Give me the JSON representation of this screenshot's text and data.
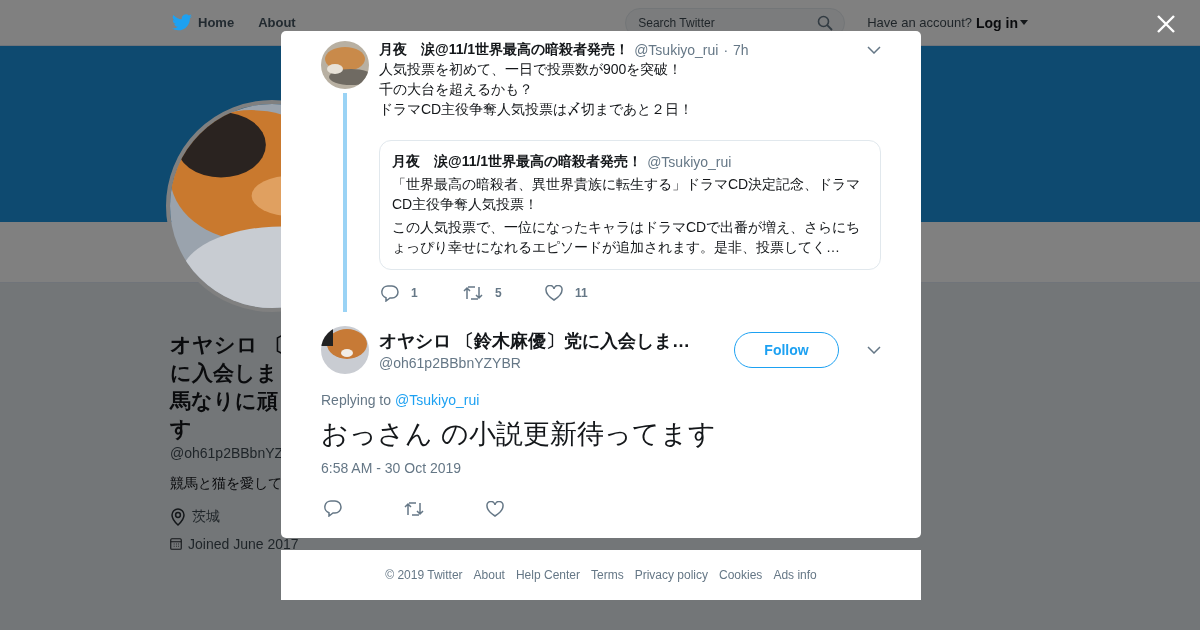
{
  "nav": {
    "links": [
      {
        "label": "Home",
        "kind": "home"
      },
      {
        "label": "About",
        "kind": "plain"
      }
    ],
    "search": {
      "placeholder": "Search Twitter"
    },
    "account_prompt": "Have an account?",
    "login": "Log in"
  },
  "profile": {
    "name_lines": [
      "オヤシロ 〔",
      "に入会しま",
      "馬なりに頑",
      "す"
    ],
    "handle": "@oh61p2BBbnYZ",
    "bio": "競馬と猫を愛して",
    "location": "茨城",
    "joined": "Joined June 2017"
  },
  "dialog": {
    "parent": {
      "name": "月夜　涙@11/1世界最高の暗殺者発売！",
      "handle": "@Tsukiyo_rui",
      "separator": "·",
      "time": "7h",
      "lines": [
        "人気投票を初めて、一日で投票数が900を突破！",
        "千の大台を超えるかも？",
        "ドラマCD主役争奪人気投票は〆切まであと２日！"
      ],
      "quote": {
        "name": "月夜　涙@11/1世界最高の暗殺者発売！",
        "handle": "@Tsukiyo_rui",
        "lines": [
          "「世界最高の暗殺者、異世界貴族に転生する」ドラマCD決定記念、ドラマCD主役争奪人気投票！",
          "この人気投票で、一位になったキャラはドラマCDで出番が増え、さらにちょっぴり幸せになれるエピソードが追加されます。是非、投票してく…"
        ]
      },
      "actions": [
        {
          "kind": "reply",
          "count": "1"
        },
        {
          "kind": "retweet",
          "count": "5"
        },
        {
          "kind": "like",
          "count": "11"
        }
      ]
    },
    "reply": {
      "name": "オヤシロ 〔鈴木麻優〕党に入会しま…",
      "handle": "@oh61p2BBbnYZYBR",
      "follow": "Follow",
      "replying_label": "Replying to",
      "replying_to": "@Tsukiyo_rui",
      "text": "おっさん の小説更新待ってます",
      "timestamp": "6:58 AM - 30 Oct 2019",
      "actions": [
        {
          "kind": "reply"
        },
        {
          "kind": "retweet"
        },
        {
          "kind": "like"
        }
      ]
    }
  },
  "footer": [
    "© 2019 Twitter",
    "About",
    "Help Center",
    "Terms",
    "Privacy policy",
    "Cookies",
    "Ads info"
  ]
}
